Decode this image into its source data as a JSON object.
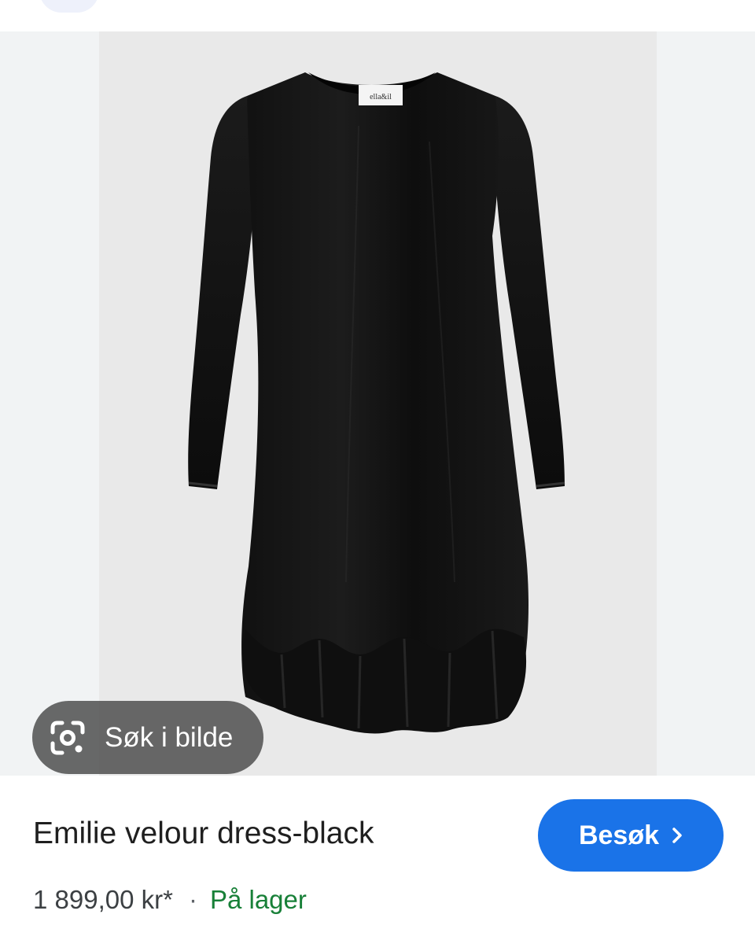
{
  "lens_button": {
    "label": "Søk i bilde",
    "icon": "google-lens-icon"
  },
  "product": {
    "title": "Emilie velour dress-black",
    "price": "1 899,00 kr*",
    "separator": "·",
    "stock_status": "På lager",
    "image_tag_text": "ella&il"
  },
  "visit_button": {
    "label": "Besøk",
    "icon": "chevron-right-icon"
  },
  "colors": {
    "accent": "#1a73e8",
    "stock_green": "#188038",
    "image_background": "#e9e9e9",
    "page_background": "#f1f3f4"
  }
}
